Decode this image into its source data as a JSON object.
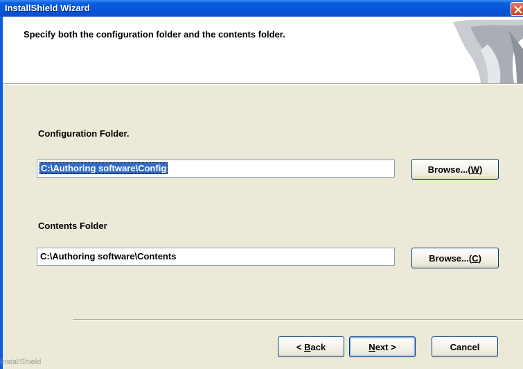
{
  "window": {
    "title": "InstallShield Wizard"
  },
  "header": {
    "title": "Specify both the configuration folder and the contents folder."
  },
  "config": {
    "label": "Configuration Folder.",
    "value": "C:\\Authoring software\\Config",
    "browse_prefix": "Browse...(",
    "browse_key": "W",
    "browse_suffix": ")"
  },
  "contents": {
    "label": "Contents Folder",
    "value": "C:\\Authoring software\\Contents",
    "browse_prefix": "Browse...(",
    "browse_key": "C",
    "browse_suffix": ")"
  },
  "footer": {
    "back_prefix": "< ",
    "back_key": "B",
    "back_rest": "ack",
    "next_key": "N",
    "next_rest": "ext >",
    "cancel": "Cancel",
    "brand": "InstallShield"
  }
}
